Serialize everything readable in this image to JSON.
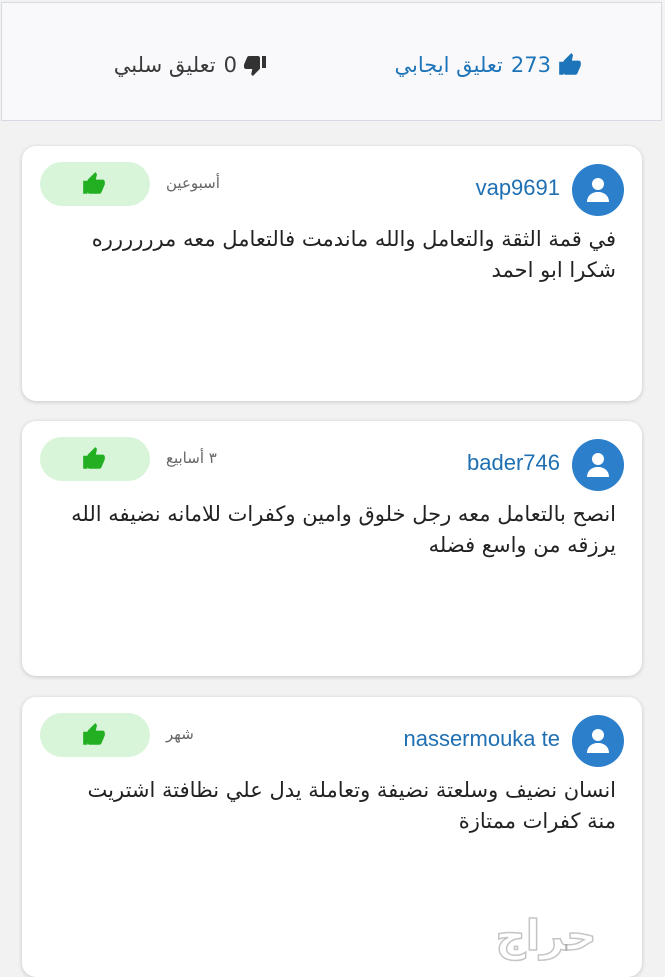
{
  "summary": {
    "positive_count": "273",
    "positive_label": "تعليق ايجابي",
    "negative_count": "0",
    "negative_label": "تعليق سلبي",
    "positive_color": "#1d74b8",
    "negative_color": "#3a3a3a"
  },
  "comments": [
    {
      "username": "vap9691",
      "time": "أسبوعين",
      "text": "في قمة الثقة والتعامل والله ماندمت فالتعامل معه مرررررره شكرا ابو احمد",
      "avatar_icon": "user-icon",
      "like_icon": "thumbs-up-icon"
    },
    {
      "username": "bader746",
      "time": "٣ أسابيع",
      "text": "انصح بالتعامل معه رجل خلوق وامين وكفرات للامانه نضيفه الله يرزقه من واسع فضله",
      "avatar_icon": "user-icon",
      "like_icon": "thumbs-up-icon"
    },
    {
      "username": "nassermouka te",
      "time": "شهر",
      "text": "انسان نضيف وسلعتة نضيفة وتعاملة يدل علي نظافتة اشتريت منة كفرات ممتازة",
      "avatar_icon": "user-icon",
      "like_icon": "thumbs-up-icon"
    }
  ],
  "colors": {
    "avatar_bg": "#2c7fcb",
    "like_green": "#22b022",
    "like_pill_bg": "#d9f5d9",
    "username_blue": "#1f6fb3"
  },
  "watermark": {
    "text": "حراج"
  }
}
